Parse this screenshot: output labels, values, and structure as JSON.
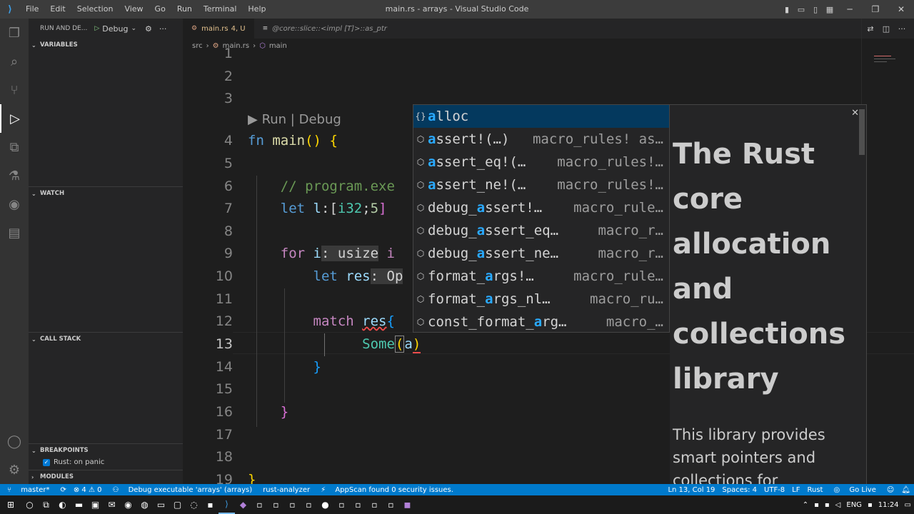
{
  "titlebar": {
    "menu": [
      "File",
      "Edit",
      "Selection",
      "View",
      "Go",
      "Run",
      "Terminal",
      "Help"
    ],
    "title": "main.rs - arrays - Visual Studio Code"
  },
  "sidebar": {
    "run_label": "RUN AND DE...",
    "debug_config": "Debug",
    "sections": {
      "variables": "VARIABLES",
      "watch": "WATCH",
      "call_stack": "CALL STACK",
      "breakpoints": "BREAKPOINTS",
      "modules": "MODULES"
    },
    "breakpoint_item": "Rust: on panic"
  },
  "tabs": [
    {
      "label": "main.rs",
      "status": "4, U"
    },
    {
      "label": "@core::slice::<impl [T]>::as_ptr"
    }
  ],
  "breadcrumbs": [
    "src",
    "main.rs",
    "main"
  ],
  "editor": {
    "line_numbers": [
      "1",
      "2",
      "3",
      "4",
      "5",
      "6",
      "7",
      "8",
      "9",
      "10",
      "11",
      "12",
      "13",
      "14",
      "15",
      "16",
      "17",
      "18",
      "19"
    ],
    "codelens": "▶ Run | Debug"
  },
  "code": {
    "l4_fn": "fn",
    "l4_name": "main",
    "l4_paren": "()",
    "l4_brace": "{",
    "l6_comment": "// program.exe",
    "l7_let": "let",
    "l7_var": "l",
    "l7_rest": ":[",
    "l7_type": "i32",
    "l7_semi": ";",
    "l7_num": "5",
    "l7_close": "]",
    "l9_for": "for",
    "l9_var": "i",
    "l9_hint": ": usize",
    "l9_in": "i",
    "l10_let": "let",
    "l10_var": "res",
    "l10_hint": ": Op",
    "l12_match": "match",
    "l12_var": "res",
    "l12_brace": "{",
    "l13_some": "Some",
    "l13_open": "(",
    "l13_a": "a",
    "l13_close": ")",
    "l14_brace": "}",
    "l16_brace": "}",
    "l19_brace": "}"
  },
  "suggestions": [
    {
      "icon": "{}",
      "prefix": "",
      "match": "a",
      "rest": "lloc",
      "detail": ""
    },
    {
      "icon": "⬡",
      "prefix": "",
      "match": "a",
      "rest": "ssert!(…)",
      "detail": "macro_rules! as…"
    },
    {
      "icon": "⬡",
      "prefix": "",
      "match": "a",
      "rest": "ssert_eq!(…",
      "detail": "macro_rules!…"
    },
    {
      "icon": "⬡",
      "prefix": "",
      "match": "a",
      "rest": "ssert_ne!(…",
      "detail": "macro_rules!…"
    },
    {
      "icon": "⬡",
      "prefix": "debug_",
      "match": "a",
      "rest": "ssert!…",
      "detail": "macro_rule…"
    },
    {
      "icon": "⬡",
      "prefix": "debug_",
      "match": "a",
      "rest": "ssert_eq…",
      "detail": "macro_r…"
    },
    {
      "icon": "⬡",
      "prefix": "debug_",
      "match": "a",
      "rest": "ssert_ne…",
      "detail": "macro_r…"
    },
    {
      "icon": "⬡",
      "prefix": "format_",
      "match": "a",
      "rest": "rgs!…",
      "detail": "macro_rule…"
    },
    {
      "icon": "⬡",
      "prefix": "format_",
      "match": "a",
      "rest": "rgs_nl…",
      "detail": "macro_ru…"
    },
    {
      "icon": "⬡",
      "prefix": "const_format_",
      "match": "a",
      "rest": "rg…",
      "detail": "macro_…"
    }
  ],
  "doc": {
    "title": "The Rust core allocation and collections library",
    "body": "This library provides smart pointers and collections for"
  },
  "statusbar": {
    "branch": "master*",
    "sync": "⟳",
    "problems": "⊗ 4 ⚠ 0",
    "debug": "Debug executable 'arrays' (arrays)",
    "analyzer": "rust-analyzer",
    "appscan": "AppScan found 0 security issues.",
    "position": "Ln 13, Col 19",
    "spaces": "Spaces: 4",
    "encoding": "UTF-8",
    "eol": "LF",
    "language": "Rust",
    "golive": "Go Live"
  },
  "taskbar": {
    "lang": "ENG",
    "time": "11:24"
  },
  "colors": {
    "accent": "#007acc",
    "selection": "#04395e",
    "match": "#2aaaff"
  }
}
